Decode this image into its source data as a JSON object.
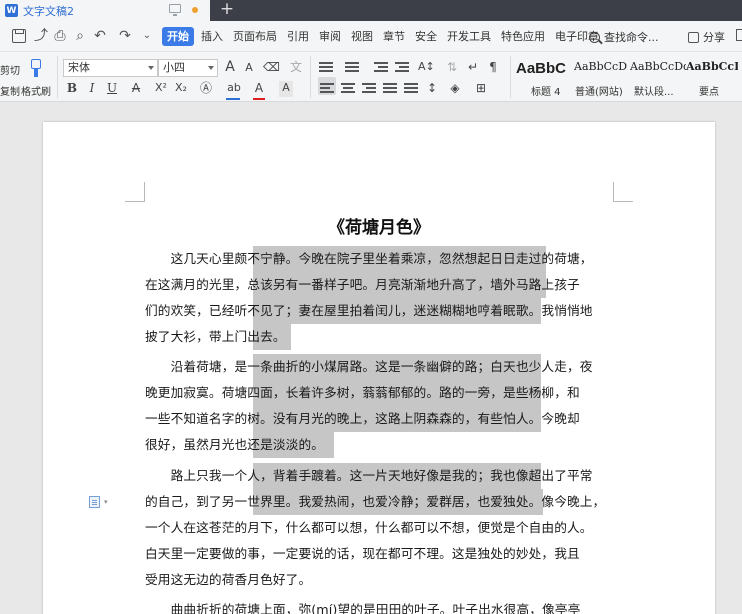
{
  "window": {
    "doc_tab_title": "文字文稿2",
    "app_logo": "W",
    "new_tab_symbol": "+"
  },
  "menu": {
    "items": [
      "开始",
      "插入",
      "页面布局",
      "引用",
      "审阅",
      "视图",
      "章节",
      "安全",
      "开发工具",
      "特色应用",
      "电子印章"
    ],
    "active": "开始",
    "search_label": "查找命令...",
    "share_label": "分享"
  },
  "ribbon": {
    "cut_label": "剪切",
    "copy_label": "复制",
    "format_painter_label": "格式刷",
    "font_name": "宋体",
    "font_size": "小四",
    "bold": "B",
    "italic": "I",
    "underline": "U",
    "strike": "A",
    "font_color_letter": "A",
    "font_color": "#e02020",
    "highlight_color": "#2f6fd6",
    "grow_font": "A",
    "shrink_font": "A",
    "styles": [
      {
        "preview": "AaBbC",
        "label": "标题 4"
      },
      {
        "preview": "AaBbCcD",
        "label": "普通(网站)"
      },
      {
        "preview": "AaBbCcDd",
        "label": "默认段..."
      },
      {
        "preview": "AaBbCcD",
        "label": "要点"
      }
    ]
  },
  "document": {
    "title": "《荷塘月色》",
    "lines": [
      "　　这几天心里颇不宁静。今晚在院子里坐着乘凉，忽然想起日日走过的荷塘，",
      "在这满月的光里，总该另有一番样子吧。月亮渐渐地升高了，墙外马路上孩子",
      "们的欢笑，已经听不见了；妻在屋里拍着闰儿，迷迷糊糊地哼着眠歌。我悄悄地",
      "披了大衫，带上门出去。",
      "　　沿着荷塘，是一条曲折的小煤屑路。这是一条幽僻的路；白天也少人走，夜",
      "晚更加寂寞。荷塘四面，长着许多树，蓊蓊郁郁的。路的一旁，是些杨柳，和",
      "一些不知道名字的树。没有月光的晚上，这路上阴森森的，有些怕人。今晚却",
      "很好，虽然月光也还是淡淡的。",
      "　　路上只我一个人，背着手踱着。这一片天地好像是我的；我也像超出了平常",
      "的自己，到了另一世界里。我爱热闹，也爱冷静；爱群居，也爱独处。像今晚上，",
      "一个人在这苍茫的月下，什么都可以想，什么都可以不想，便觉是个自由的人。",
      "白天里一定要做的事，一定要说的话，现在都可不理。这是独处的妙处，我且",
      "受用这无边的荷香月色好了。",
      "　　曲曲折折的荷塘上面，弥(mí)望的是田田的叶子。叶子出水很高，像亭亭"
    ]
  },
  "colors": {
    "accent": "#3b7be8",
    "selection": "#c6c6c6",
    "titlebar": "#3c3f47",
    "modified_dot": "#f0a030"
  },
  "icons": [
    "wps-logo-icon",
    "monitor-icon",
    "save-icon",
    "undo-icon",
    "redo-icon",
    "print-icon",
    "search-icon",
    "share-icon",
    "format-painter-icon",
    "doc-float-icon"
  ]
}
